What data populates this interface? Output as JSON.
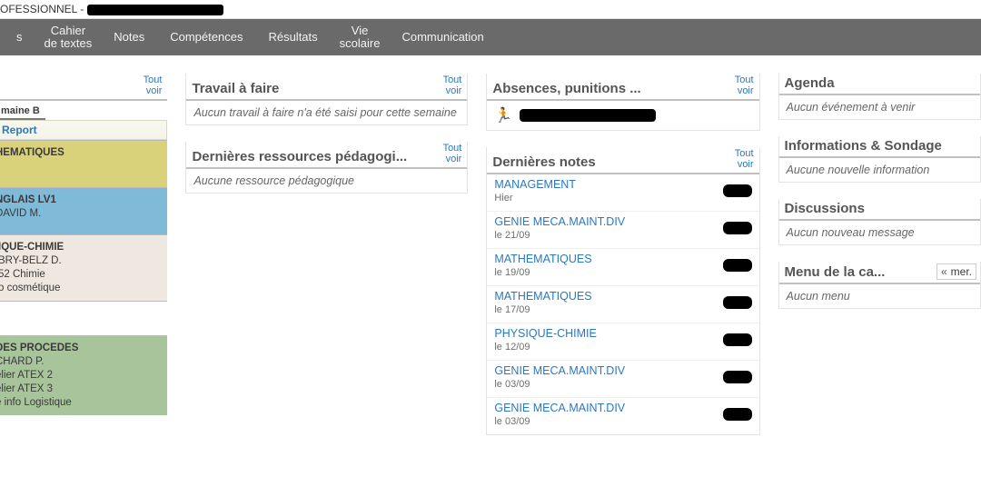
{
  "topbar": {
    "prefix": "OFESSIONNEL -"
  },
  "menu": {
    "home": "s",
    "cahier_l1": "Cahier",
    "cahier_l2": "de textes",
    "notes": "Notes",
    "competences": "Compétences",
    "resultats": "Résultats",
    "vie_l1": "Vie",
    "vie_l2": "scolaire",
    "comm": "Communication"
  },
  "common": {
    "tout": "Tout",
    "voir": "voir"
  },
  "timetable": {
    "week": "maine B",
    "report": "Report",
    "slots": [
      {
        "cls": "math",
        "lines": [
          "HEMATIQUES"
        ]
      },
      {
        "cls": "ang",
        "lines": [
          "NGLAIS LV1",
          "DAVID M."
        ]
      },
      {
        "cls": "chim",
        "lines": [
          "IQUE-CHIMIE",
          "BRY-BELZ D.",
          "52 Chimie",
          "o cosmétique"
        ]
      },
      {
        "cls": "blank",
        "lines": []
      },
      {
        "cls": "proc",
        "lines": [
          "DES PROCEDES",
          "CHARD P.",
          "elier ATEX 2",
          "elier ATEX 3",
          "e info Logistique"
        ]
      }
    ]
  },
  "work": {
    "title": "Travail à faire",
    "empty": "Aucun travail à faire n'a été saisi pour cette semaine"
  },
  "res": {
    "title": "Dernières ressources pédagogi...",
    "empty": "Aucune ressource pédagogique"
  },
  "abs": {
    "title": "Absences, punitions ..."
  },
  "grades": {
    "title": "Dernières notes",
    "rows": [
      {
        "subj": "MANAGEMENT",
        "date": "Hier"
      },
      {
        "subj": "GENIE MECA.MAINT.DIV",
        "date": "le 21/09"
      },
      {
        "subj": "MATHEMATIQUES",
        "date": "le 19/09"
      },
      {
        "subj": "MATHEMATIQUES",
        "date": "le 17/09"
      },
      {
        "subj": "PHYSIQUE-CHIMIE",
        "date": "le 12/09"
      },
      {
        "subj": "GENIE MECA.MAINT.DIV",
        "date": "le 03/09"
      },
      {
        "subj": "GENIE MECA.MAINT.DIV",
        "date": "le 03/09"
      }
    ]
  },
  "agenda": {
    "title": "Agenda",
    "empty": "Aucun événement à venir"
  },
  "info": {
    "title": "Informations & Sondage",
    "empty": "Aucune nouvelle information"
  },
  "disc": {
    "title": "Discussions",
    "empty": "Aucun nouveau message"
  },
  "cantine": {
    "title": "Menu de la ca...",
    "day": "mer. ",
    "empty": "Aucun menu"
  }
}
